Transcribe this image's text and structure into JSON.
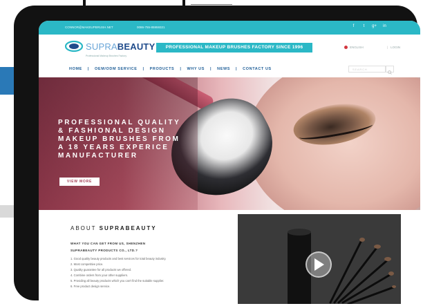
{
  "topbar": {
    "email": "CONNOR@MAKEUPBRUSH.NET",
    "phone": "0086-755-85959321",
    "social": [
      "f",
      "t",
      "g+",
      "in"
    ]
  },
  "brand": {
    "logo_prefix": "SUPRA",
    "logo_suffix": "BEAUTY",
    "tagline": "Professional Makeup Brushes Factory",
    "banner": "PROFESSIONAL MAKEUP BRUSHES FACTORY SINCE 1996",
    "language": "ENGLISH",
    "login": "LOGIN"
  },
  "nav": {
    "items": [
      "HOME",
      "OEM/ODM SERVICE",
      "PRODUCTS",
      "WHY US",
      "NEWS",
      "CONTACT US"
    ],
    "search_placeholder": "SEARCH"
  },
  "hero": {
    "headline_lines": [
      "PROFESSIONAL QUALITY",
      "& FASHIONAL DESIGN",
      "MAKEUP BRUSHES FROM",
      "A 18 YEARS EXPERICE",
      "MANUFACTURER"
    ],
    "button": "VIEW MORE"
  },
  "about": {
    "title_prefix": "ABOUT",
    "title_brand": "SUPRABEAUTY",
    "question_line1": "WHAT YOU CAN GET FROM US, SHENZHEN",
    "question_line2": "SUPRABEAUTY PRODUCTS CO., LTD.?",
    "list": [
      "1. Good quality beauty products and best services for total beauty industry.",
      "2. Most competitive price.",
      "3. Quality guarantee for all products we offered.",
      "4. Combine orders from your other suppliers.",
      "5. Providing all beauty products which you can't find the suitable supplier.",
      "6. Free product design service."
    ]
  },
  "colors": {
    "accent": "#2bb8c6",
    "brand_blue": "#1c5c96",
    "hero_button_text": "#a33f55"
  }
}
